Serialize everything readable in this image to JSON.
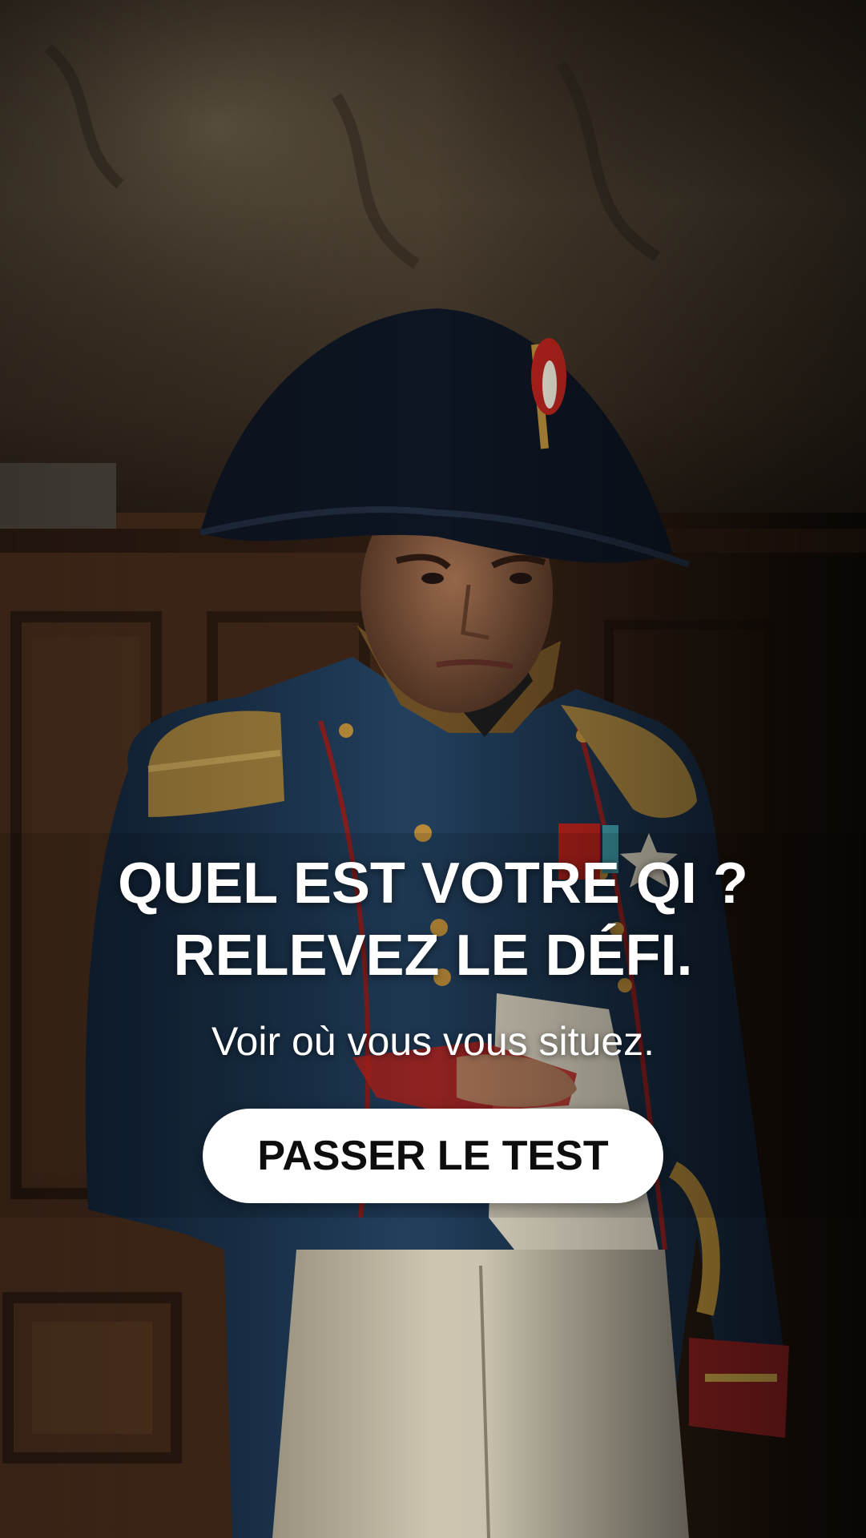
{
  "hero": {
    "image": "painted-portrait-of-emperor-in-bicorne-hat-and-blue-uniform",
    "headline_line1": "QUEL EST VOTRE QI ?",
    "headline_line2": "RELEVEZ LE DÉFI.",
    "subheadline": "Voir où vous vous situez.",
    "cta_label": "PASSER LE TEST"
  },
  "colors": {
    "text": "#ffffff",
    "button_bg": "#ffffff",
    "button_text": "#0d0d0d",
    "uniform_blue": "#1f3550",
    "wood_brown": "#3a2417"
  }
}
